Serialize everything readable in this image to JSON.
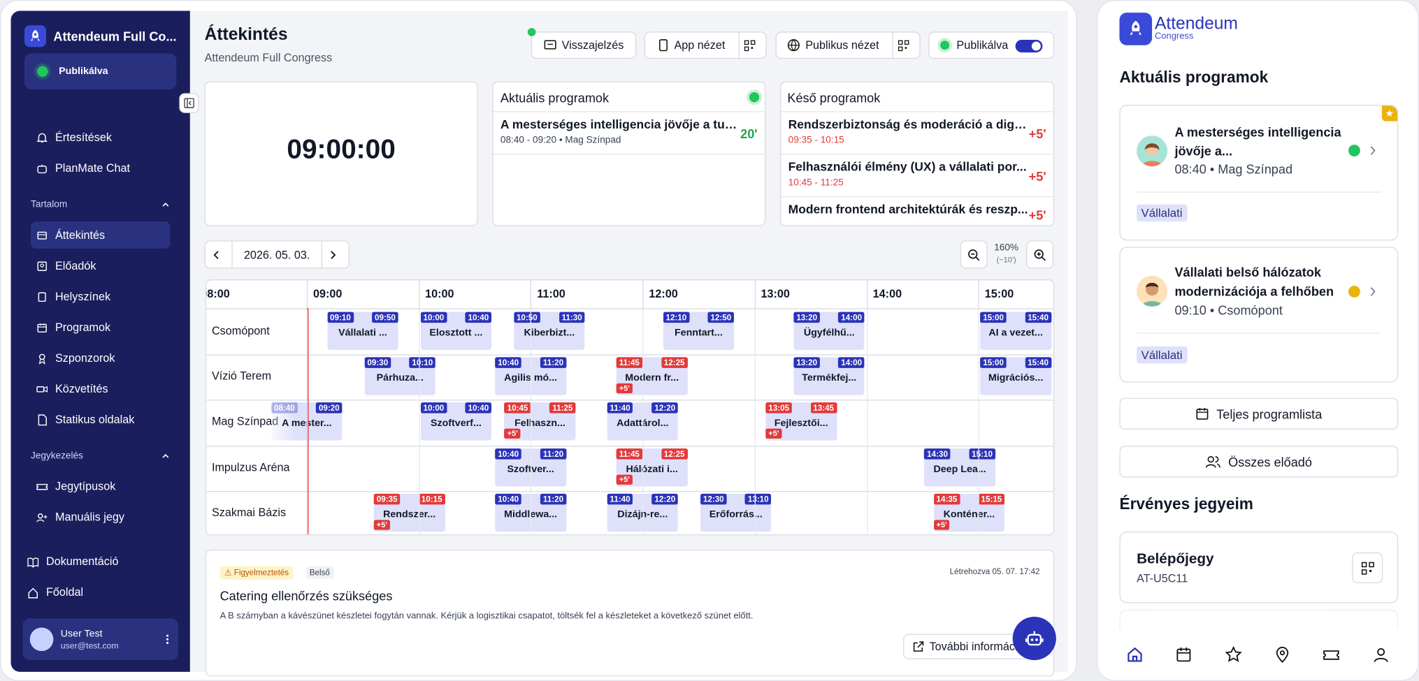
{
  "sidebar": {
    "app_title": "Attendeum Full Co...",
    "publish_status": "Publikálva",
    "items": [
      {
        "label": "Értesítések",
        "icon": "bell-icon"
      },
      {
        "label": "PlanMate Chat",
        "icon": "chat-bot-icon"
      },
      {
        "label": "Áttekintés",
        "icon": "overview-icon"
      },
      {
        "label": "Előadók",
        "icon": "speaker-icon"
      },
      {
        "label": "Helyszínek",
        "icon": "venue-icon"
      },
      {
        "label": "Programok",
        "icon": "calendar-icon"
      },
      {
        "label": "Szponzorok",
        "icon": "sponsor-icon"
      },
      {
        "label": "Közvetítés",
        "icon": "video-icon"
      },
      {
        "label": "Statikus oldalak",
        "icon": "page-icon"
      },
      {
        "label": "Jegytípusok",
        "icon": "ticket-icon"
      },
      {
        "label": "Manuális jegy",
        "icon": "user-plus-icon"
      },
      {
        "label": "Dokumentáció",
        "icon": "book-icon"
      },
      {
        "label": "Főoldal",
        "icon": "home-icon"
      }
    ],
    "sections": {
      "content": "Tartalom",
      "tickets": "Jegykezelés"
    },
    "user": {
      "name": "User Test",
      "email": "user@test.com"
    }
  },
  "header": {
    "title": "Áttekintés",
    "subtitle": "Attendeum Full Congress",
    "feedback": "Visszajelzés",
    "app_view": "App nézet",
    "public_view": "Publikus nézet",
    "published": "Publikálva"
  },
  "clock": "09:00:00",
  "current": {
    "title": "Aktuális programok",
    "items": [
      {
        "title": "A mesterséges intelligencia jövője a tud...",
        "sub": "08:40 - 09:20 • Mag Színpad",
        "badge": "20'"
      }
    ]
  },
  "late": {
    "title": "Késő programok",
    "items": [
      {
        "title": "Rendszerbiztonság és moderáció a digit...",
        "sub": "09:35 - 10:15",
        "badge": "+5'"
      },
      {
        "title": "Felhasználói élmény (UX) a vállalati por...",
        "sub": "10:45 - 11:25",
        "badge": "+5'"
      },
      {
        "title": "Modern frontend architektúrák és reszp...",
        "sub": "",
        "badge": "+5'"
      }
    ]
  },
  "timeline": {
    "date": "2026. 05. 03.",
    "zoom": "160%",
    "zoom_sub": "(~10')",
    "hours": [
      "08:00",
      "09:00",
      "10:00",
      "11:00",
      "12:00",
      "13:00",
      "14:00",
      "15:00"
    ],
    "rooms": [
      "Csomópont",
      "Vízió Terem",
      "Mag Színpad",
      "Impulzus Aréna",
      "Szakmai Bázis"
    ],
    "late_label": "+5'",
    "events": [
      {
        "room": 0,
        "start": "09:10",
        "end": "09:50",
        "title": "Vállalati ..."
      },
      {
        "room": 0,
        "start": "10:00",
        "end": "10:40",
        "title": "Elosztott ..."
      },
      {
        "room": 0,
        "start": "10:50",
        "end": "11:30",
        "title": "Kiberbizt..."
      },
      {
        "room": 0,
        "start": "12:10",
        "end": "12:50",
        "title": "Fenntart..."
      },
      {
        "room": 0,
        "start": "13:20",
        "end": "14:00",
        "title": "Ügyfélhű..."
      },
      {
        "room": 0,
        "start": "15:00",
        "end": "15:40",
        "title": "AI a vezet..."
      },
      {
        "room": 1,
        "start": "09:30",
        "end": "10:10",
        "title": "Párhuza..."
      },
      {
        "room": 1,
        "start": "10:40",
        "end": "11:20",
        "title": "Agilis mó..."
      },
      {
        "room": 1,
        "start": "11:45",
        "end": "12:25",
        "title": "Modern fr...",
        "late": true
      },
      {
        "room": 1,
        "start": "13:20",
        "end": "14:00",
        "title": "Termékfej..."
      },
      {
        "room": 1,
        "start": "15:00",
        "end": "15:40",
        "title": "Migrációs..."
      },
      {
        "room": 2,
        "start": "08:40",
        "end": "09:20",
        "title": "A mester...",
        "current": true
      },
      {
        "room": 2,
        "start": "10:00",
        "end": "10:40",
        "title": "Szoftverf..."
      },
      {
        "room": 2,
        "start": "10:45",
        "end": "11:25",
        "title": "Felhaszn...",
        "late": true
      },
      {
        "room": 2,
        "start": "11:40",
        "end": "12:20",
        "title": "Adattárol..."
      },
      {
        "room": 2,
        "start": "13:05",
        "end": "13:45",
        "title": "Fejlesztői...",
        "late": true
      },
      {
        "room": 3,
        "start": "10:40",
        "end": "11:20",
        "title": "Szoftver..."
      },
      {
        "room": 3,
        "start": "11:45",
        "end": "12:25",
        "title": "Hálózati i...",
        "late": true
      },
      {
        "room": 3,
        "start": "14:30",
        "end": "15:10",
        "title": "Deep Lea..."
      },
      {
        "room": 4,
        "start": "09:35",
        "end": "10:15",
        "title": "Rendszer...",
        "late": true
      },
      {
        "room": 4,
        "start": "10:40",
        "end": "11:20",
        "title": "Middlewa..."
      },
      {
        "room": 4,
        "start": "11:40",
        "end": "12:20",
        "title": "Dizájn-re..."
      },
      {
        "room": 4,
        "start": "12:30",
        "end": "13:10",
        "title": "Erőforrás..."
      },
      {
        "room": 4,
        "start": "14:35",
        "end": "15:15",
        "title": "Konténer...",
        "late": true
      }
    ]
  },
  "notice": {
    "tag_warning": "Figyelmeztetés",
    "tag_internal": "Belső",
    "created": "Létrehozva 05. 07. 17:42",
    "title": "Catering ellenőrzés szükséges",
    "body": "A B szárnyban a kávészünet készletei fogytán vannak. Kérjük a logisztikai csapatot, töltsék fel a készleteket a következő szünet előtt.",
    "more": "További információ"
  },
  "mobile": {
    "brand": "Attendeum",
    "brand_sub": "Congress",
    "current_title": "Aktuális programok",
    "cards": [
      {
        "title1": "A mesterséges intelligencia",
        "title2": "jövője a...",
        "sub": "08:40 • Mag Színpad",
        "tag": "Vállalati",
        "status": "#22c55e"
      },
      {
        "title1": "Vállalati belső hálózatok",
        "title2": "modernizációja a felhőben",
        "sub": "09:10 • Csomópont",
        "tag": "Vállalati",
        "status": "#eab308"
      }
    ],
    "full_list": "Teljes programlista",
    "all_speakers": "Összes előadó",
    "tickets_title": "Érvényes jegyeim",
    "ticket": {
      "name": "Belépőjegy",
      "code": "AT-U5C11"
    }
  },
  "colors": {
    "navy": "#1a1e5c",
    "accent": "#2b33b8",
    "late": "#e23a3a",
    "ok": "#22c55e"
  }
}
